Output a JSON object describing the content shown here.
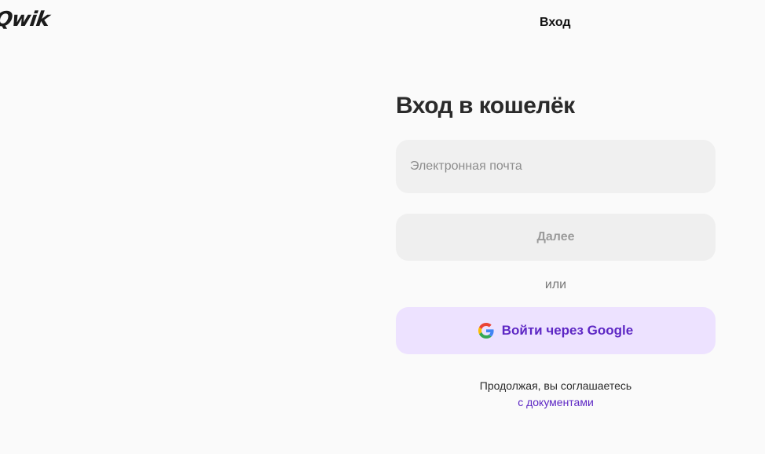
{
  "brand": {
    "logo_text": "Qwik"
  },
  "header": {
    "title": "Вход"
  },
  "login": {
    "heading": "Вход в кошелёк",
    "email": {
      "placeholder": "Электронная почта",
      "value": ""
    },
    "next_label": "Далее",
    "separator": "или",
    "google_label": "Войти через Google",
    "terms_text": "Продолжая, вы соглашаетесь",
    "terms_link": "с документами"
  },
  "icons": {
    "google": "google-icon"
  },
  "colors": {
    "accent": "#5d27c4",
    "google_button_bg": "#ede2ff",
    "background": "#fafafa"
  }
}
